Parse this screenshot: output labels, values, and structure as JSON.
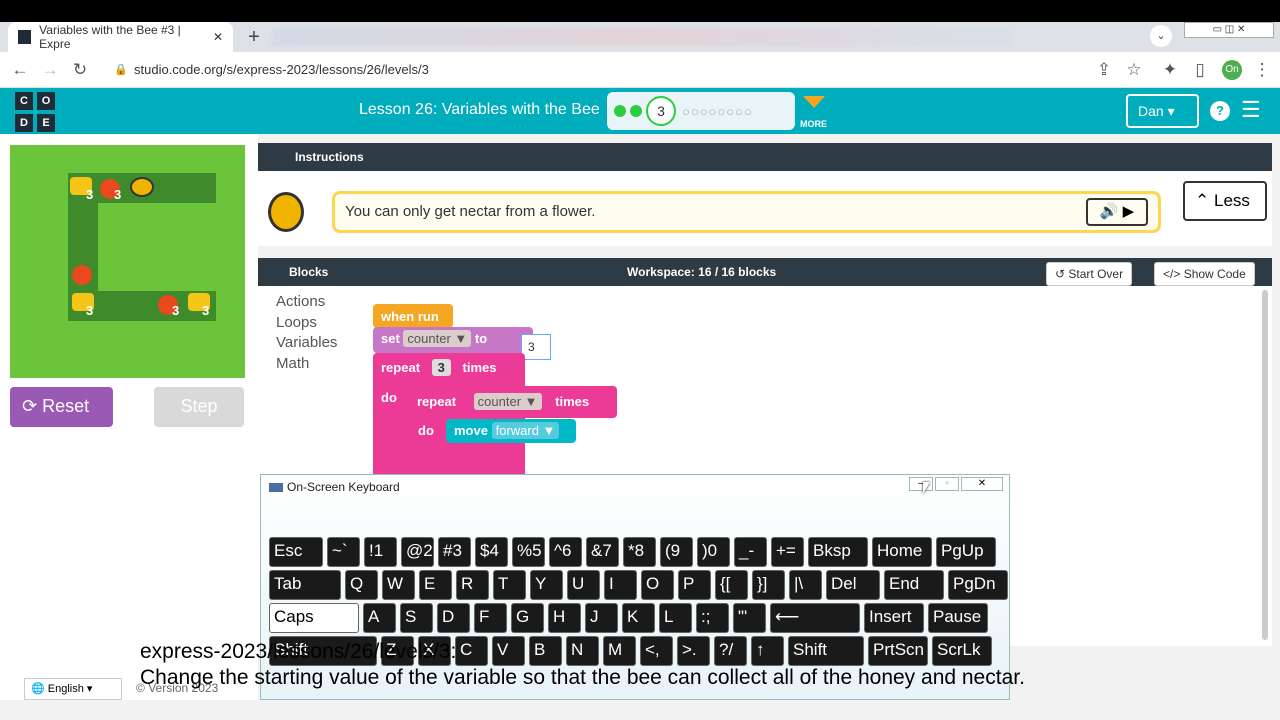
{
  "browser": {
    "tab_title": "Variables with the Bee #3 | Expre",
    "tab_close": "✕",
    "new_tab": "+",
    "url": "studio.code.org/s/express-2023/lessons/26/levels/3",
    "profile": "On"
  },
  "header": {
    "logo_letters": [
      "C",
      "O",
      "D",
      "E"
    ],
    "lesson_title": "Lesson 26: Variables with the Bee",
    "current_level": "3",
    "more_label": "MORE",
    "user_button": "Dan",
    "help": "?"
  },
  "game": {
    "reset_label": "Reset",
    "step_label": "Step",
    "honey_counts": [
      "3",
      "3",
      "3",
      "3",
      "3"
    ]
  },
  "instructions": {
    "tab_label": "Instructions",
    "text": "You can only get nectar from a flower.",
    "less_label": "Less"
  },
  "workspace": {
    "blocks_label": "Blocks",
    "title": "Workspace: 16 / 16 blocks",
    "start_over": "Start Over",
    "show_code": "Show Code",
    "categories": [
      "Actions",
      "Loops",
      "Variables",
      "Math"
    ],
    "when_run": "when run",
    "set": "set",
    "variable": "counter ▼",
    "to": "to",
    "edit_value": "3",
    "repeat": "repeat",
    "repeat_count": "3",
    "times": "times",
    "do": "do",
    "move": "move",
    "direction": "forward ▼"
  },
  "osk": {
    "title": "On-Screen Keyboard",
    "row1": [
      "Esc",
      "~`",
      "!1",
      "@2",
      "#3",
      "$4",
      "%5",
      "^6",
      "&7",
      "*8",
      "(9",
      ")0",
      "_-",
      "+=",
      "Bksp",
      "Home",
      "PgUp"
    ],
    "row2": [
      "Tab",
      "Q",
      "W",
      "E",
      "R",
      "T",
      "Y",
      "U",
      "I",
      "O",
      "P",
      "{[",
      "}]",
      "|\\",
      "Del",
      "End",
      "PgDn"
    ],
    "row3": [
      "Caps",
      "A",
      "S",
      "D",
      "F",
      "G",
      "H",
      "J",
      "K",
      "L",
      ":;",
      "\"'",
      "⟵",
      "Insert",
      "Pause"
    ],
    "row4": [
      "Shift",
      "Z",
      "X",
      "C",
      "V",
      "B",
      "N",
      "M",
      "<,",
      ">.",
      "?/",
      "↑",
      "Shift",
      "PrtScn",
      "ScrLk"
    ]
  },
  "footer": {
    "language": "English",
    "version": "Version 2023"
  },
  "captions": {
    "line1": "express-2023/lessons/26/levels/3:",
    "line2": "Change the starting value of the variable so that the bee can collect all of the honey and nectar."
  },
  "colors": {
    "teal": "#00adbc",
    "purple": "#9b59b6",
    "pink": "#e91e8c",
    "orange": "#f5a623"
  }
}
